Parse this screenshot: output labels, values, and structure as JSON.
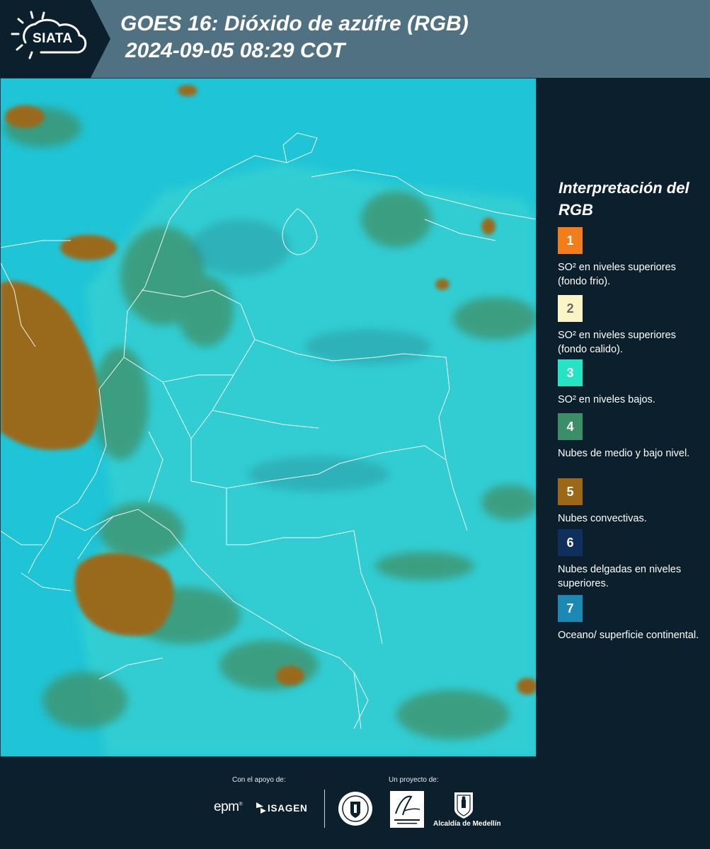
{
  "header": {
    "logo_text": "SIATA",
    "title": "GOES 16: Dióxido de azúfre (RGB)",
    "subtitle": "2024-09-05 08:29 COT"
  },
  "map": {
    "ocean_color": "#19c6d8",
    "land_color": "#2bd3d6",
    "convective_color": "#9a6a1c",
    "low_cloud_color": "#3f8f66",
    "border_color": "#ffffff"
  },
  "legend": {
    "title": "Interpretación del RGB",
    "items": [
      {
        "number": "1",
        "label": "SO² en niveles superiores (fondo frio).",
        "color": "#f17e1a",
        "text_color": "#ffffff"
      },
      {
        "number": "2",
        "label": "SO² en niveles superiores (fondo calido).",
        "color": "#fbf5c6",
        "text_color": "#666666"
      },
      {
        "number": "3",
        "label": "SO² en niveles bajos.",
        "color": "#25e3c3",
        "text_color": "#ffffff"
      },
      {
        "number": "4",
        "label": "Nubes de medio y bajo nivel.",
        "color": "#3b8e67",
        "text_color": "#ffffff"
      },
      {
        "number": "5",
        "label": "Nubes convectivas.",
        "color": "#9c6717",
        "text_color": "#ffffff"
      },
      {
        "number": "6",
        "label": "Nubes delgadas en niveles superiores.",
        "color": "#0f2f5c",
        "text_color": "#ffffff"
      },
      {
        "number": "7",
        "label": "Oceano/ superficie continental.",
        "color": "#1c89b5",
        "text_color": "#ffffff"
      }
    ]
  },
  "footer": {
    "support_label": "Con el apoyo de:",
    "project_label": "Un proyecto de:",
    "epm": "epm",
    "isagen": "ISAGEN",
    "alcaldia": "Alcaldía de Medellín"
  }
}
